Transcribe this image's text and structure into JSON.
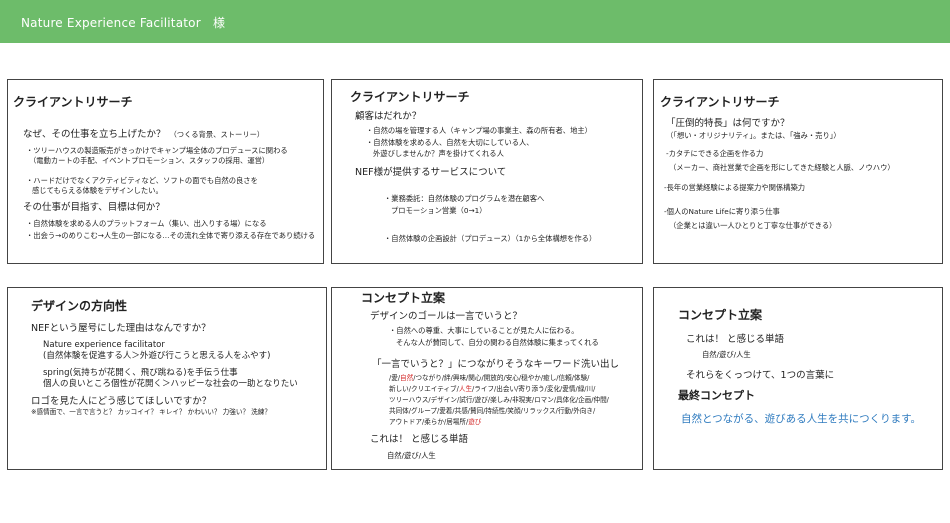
{
  "header": {
    "title": "Nature Experience Facilitator　様"
  },
  "card1": {
    "title": "クライアントリサーチ",
    "q1": "なぜ、その仕事を立ち上げたか？",
    "q1_note": "（つくる背景、ストーリー）",
    "l1": "・ツリーハウスの製造販売がきっかけでキャンプ場全体のプロデュースに関わる",
    "l2": "（電動カートの手配、イベントプロモーション、スタッフの採用、運営）",
    "l3": "・ハードだけでなくアクティビティなど、ソフトの面でも自然の良さを",
    "l4": "感じてもらえる体験をデザインしたい。",
    "q2": "その仕事が目指す、目標は何か？",
    "l5": "・自然体験を求める人のプラットフォーム（集い、出入りする場）になる",
    "l6": "・出会う→のめりこむ→人生の一部になる…その流れ全体で寄り添える存在であり続ける"
  },
  "card2": {
    "title": "クライアントリサーチ",
    "q1": "顧客はだれか？",
    "l1": "・自然の場を管理する人（キャンプ場の事業主、森の所有者、地主）",
    "l2": "・自然体験を求める人、自然を大切にしている人、",
    "l3": "外遊びしませんか？声を掛けてくれる人",
    "q2": "NEF様が提供するサービスについて",
    "l4": "・業務委託：自然体験のプログラムを潜在顧客へ",
    "l5": "プロモーション営業（0→1）",
    "l6": "・自然体験の企画設計（プロデュース）（1から全体構想を作る）"
  },
  "card3": {
    "title": "クライアントリサーチ",
    "q1": "「圧倒的特長」は何ですか？",
    "q1_note": "（「想い・オリジナリティ」。または、「強み・売り」）",
    "l1": "-カタチにできる企画を作る力",
    "l2": "（メーカー、商社営業で企画を形にしてきた経験と人脈、ノウハウ）",
    "l3": "-長年の営業経験による提案力や関係構築力",
    "l4": "-個人のNature Lifeに寄り添う仕事",
    "l5": "（企業とは違い一人ひとりと丁寧な仕事ができる）"
  },
  "card4": {
    "title": "デザインの方向性",
    "q1": "NEFという屋号にした理由はなんですか？",
    "l1": "Nature experience facilitator",
    "l2": "(自然体験を促進する人＞外遊び行こうと思える人をふやす)",
    "l3": "spring(気持ちが花開く、飛び跳ねる)を手伝う仕事",
    "l4": "個人の良いところ個性が花開く＞ハッピーな社会の一助となりたい",
    "q2": "ロゴを見た人にどう感じてほしいですか？",
    "note": "※感情面で、一言で言うと？ カッコイイ？ キレイ？ かわいい？ 力強い？ 洗練？"
  },
  "card5": {
    "title": "コンセプト立案",
    "q1": "デザインのゴールは一言でいうと？",
    "l1": "・自然への尊重、大事にしていることが見た人に伝わる。",
    "l2": "そんな人が賛同して、自分の関わる自然体験に集まってくれる",
    "q2": "「一言でいうと？」につながりそうなキーワード洗い出し",
    "k1a": "/愛/",
    "k1b": "自然",
    "k1c": "/つながり/絆/興味/関心/開放的/安心/穏やか/癒し/信頼/体験/",
    "k2a": "新しい/クリエイティブ/",
    "k2b": "人生",
    "k2c": "/ライフ/出会い/寄り添う/変化/愛情/緑/川/",
    "k3": "ツリーハウス/デザイン/試行/遊び/楽しみ/非現実/ロマン/具体化/企画/仲間/",
    "k4": "共同体/グループ/愛着/共感/賛同/持続性/笑顔/リラックス/行動/外向き/",
    "k5a": "アウトドア/柔らか/居場所/",
    "k5b": "遊び",
    "q3": "これは！ と感じる単語",
    "l3": "自然/遊び/人生"
  },
  "card6": {
    "title": "コンセプト立案",
    "q1": "これは！ と感じる単語",
    "l1": "自然/遊び/人生",
    "q2": "それらをくっつけて、1つの言葉に",
    "final_title": "最終コンセプト",
    "final": "自然とつながる、遊びある人生を共につくります。"
  }
}
